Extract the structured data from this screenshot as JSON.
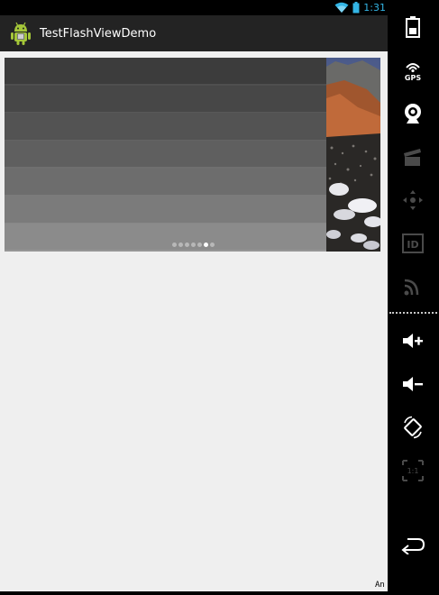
{
  "status_bar": {
    "time": "1:31",
    "wifi_icon": "wifi-icon",
    "battery_icon": "battery-icon",
    "accent_color": "#33b5e5"
  },
  "action_bar": {
    "app_icon": "android-robot-icon",
    "title": "TestFlashViewDemo"
  },
  "flash_view": {
    "page_count": 7,
    "active_page": 6,
    "band_colors": [
      "#3c3c3c",
      "#474747",
      "#535353",
      "#5f5f5f",
      "#6d6d6d",
      "#7b7b7b",
      "#8b8b8b"
    ],
    "next_slide_image": "rocky-beach-photo"
  },
  "control_panel": {
    "buttons": [
      {
        "name": "power-icon",
        "enabled": true
      },
      {
        "name": "gps-icon",
        "label": "GPS",
        "enabled": true
      },
      {
        "name": "camera-icon",
        "enabled": true
      },
      {
        "name": "clapper-icon",
        "enabled": false
      },
      {
        "name": "dpad-icon",
        "enabled": false
      },
      {
        "name": "id-icon",
        "label": "ID",
        "enabled": false
      },
      {
        "name": "rss-icon",
        "enabled": false
      },
      {
        "name": "volume-up-icon",
        "enabled": true
      },
      {
        "name": "volume-down-icon",
        "enabled": true
      },
      {
        "name": "rotate-icon",
        "enabled": true
      },
      {
        "name": "scale-icon",
        "label": "1:1",
        "enabled": false
      },
      {
        "name": "back-icon",
        "enabled": true
      }
    ]
  },
  "footer": {
    "text": "An"
  }
}
